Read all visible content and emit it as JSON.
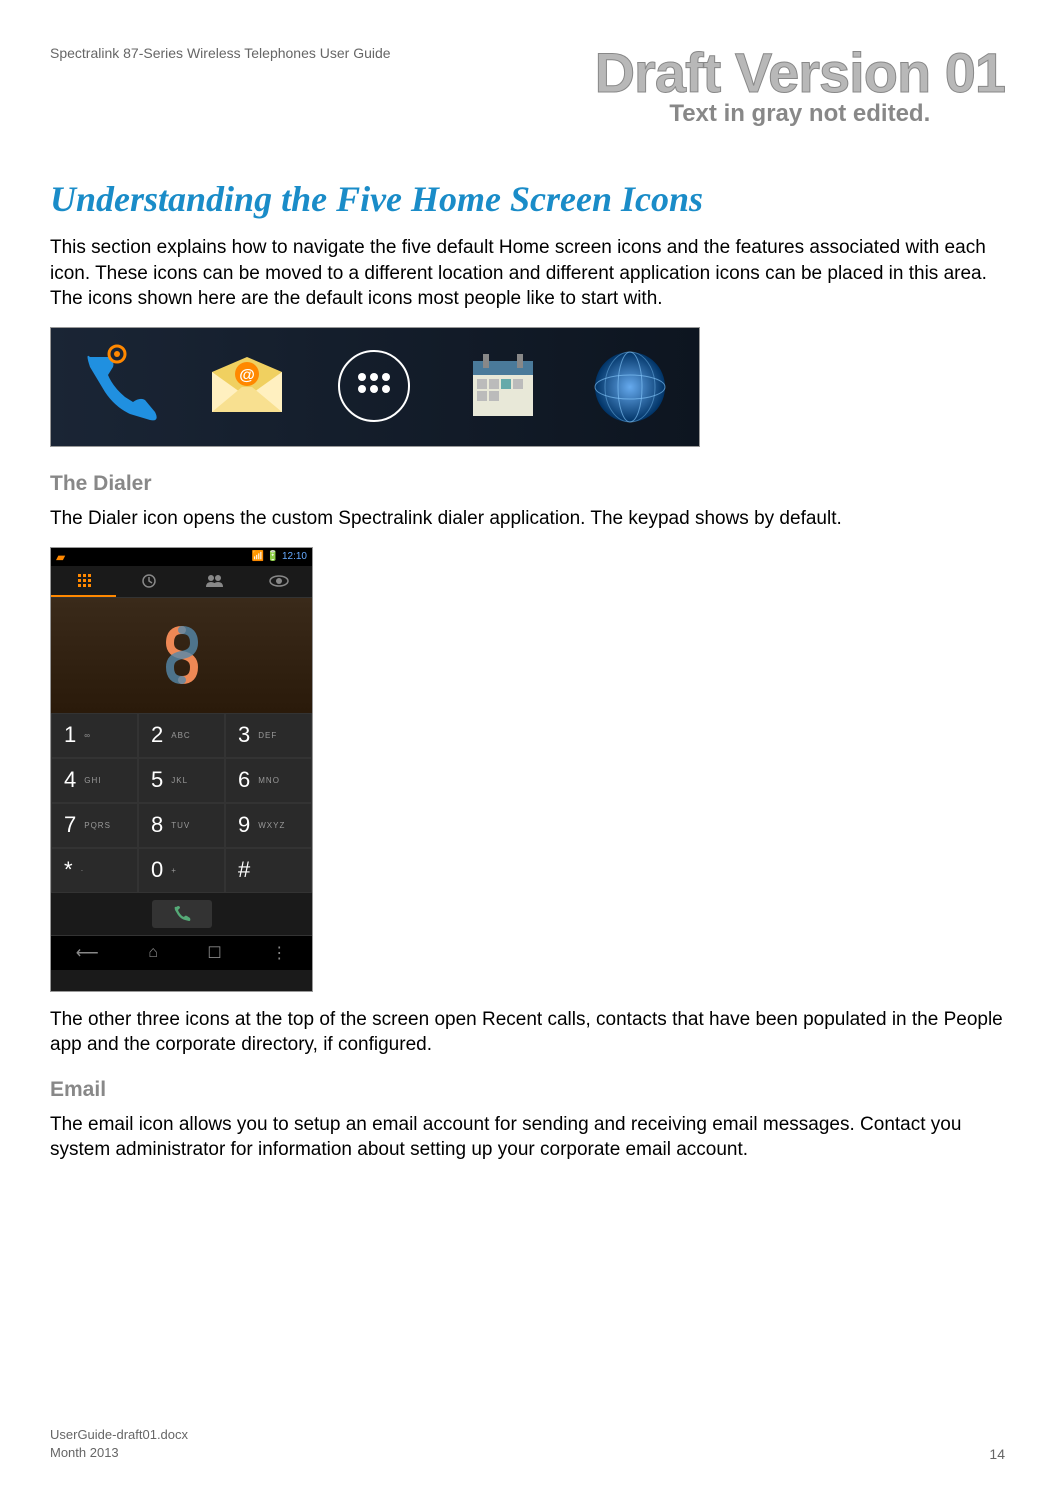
{
  "header": {
    "guide_title": "Spectralink 87-Series Wireless Telephones User Guide",
    "draft_title": "Draft Version 01",
    "draft_subtitle": "Text in gray not edited."
  },
  "section": {
    "title": "Understanding the Five Home Screen Icons",
    "intro": "This section explains how to navigate the five default Home screen icons and the features associated with each icon. These icons can be moved to a different location and different application icons can be placed in this area. The icons shown here are the default icons most people like to start with."
  },
  "home_icons": [
    {
      "name": "dialer-icon"
    },
    {
      "name": "email-icon"
    },
    {
      "name": "apps-icon"
    },
    {
      "name": "calendar-icon"
    },
    {
      "name": "browser-icon"
    }
  ],
  "dialer": {
    "heading": "The Dialer",
    "text1": "The Dialer icon opens the custom Spectralink dialer application. The keypad shows by default.",
    "text2": "The other three icons at the top of the screen open Recent calls, contacts that have been populated in the People app and the corporate directory, if configured."
  },
  "phone": {
    "time": "12:10",
    "keypad": [
      {
        "num": "1",
        "letters": "∞"
      },
      {
        "num": "2",
        "letters": "ABC"
      },
      {
        "num": "3",
        "letters": "DEF"
      },
      {
        "num": "4",
        "letters": "GHI"
      },
      {
        "num": "5",
        "letters": "JKL"
      },
      {
        "num": "6",
        "letters": "MNO"
      },
      {
        "num": "7",
        "letters": "PQRS"
      },
      {
        "num": "8",
        "letters": "TUV"
      },
      {
        "num": "9",
        "letters": "WXYZ"
      },
      {
        "num": "*",
        "letters": "·"
      },
      {
        "num": "0",
        "letters": "+"
      },
      {
        "num": "#",
        "letters": ""
      }
    ]
  },
  "email": {
    "heading": "Email",
    "text": "The email icon allows you to setup an email account for sending and receiving email messages. Contact you system administrator for information about setting up your corporate email account."
  },
  "footer": {
    "filename": "UserGuide-draft01.docx",
    "date": "Month 2013",
    "page": "14"
  }
}
